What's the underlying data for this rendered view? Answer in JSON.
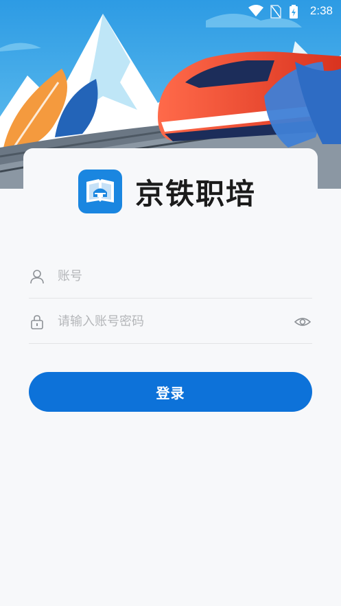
{
  "status_bar": {
    "time": "2:38",
    "icons": [
      "wifi-icon",
      "no-sim-icon",
      "battery-charging-icon"
    ]
  },
  "app": {
    "name": "京铁职培",
    "logo_icon": "book-temple-logo-icon"
  },
  "form": {
    "account_placeholder": "账号",
    "account_icon": "user-icon",
    "password_placeholder": "请输入账号密码",
    "password_icon": "lock-icon",
    "visibility_icon": "eye-icon"
  },
  "login_button": {
    "label": "登录"
  },
  "colors": {
    "primary": "#0d72d9",
    "logo_bg": "#1a86e0",
    "sky": "#3aa6e8",
    "train_red": "#e8462e",
    "background": "#f7f8fa"
  }
}
